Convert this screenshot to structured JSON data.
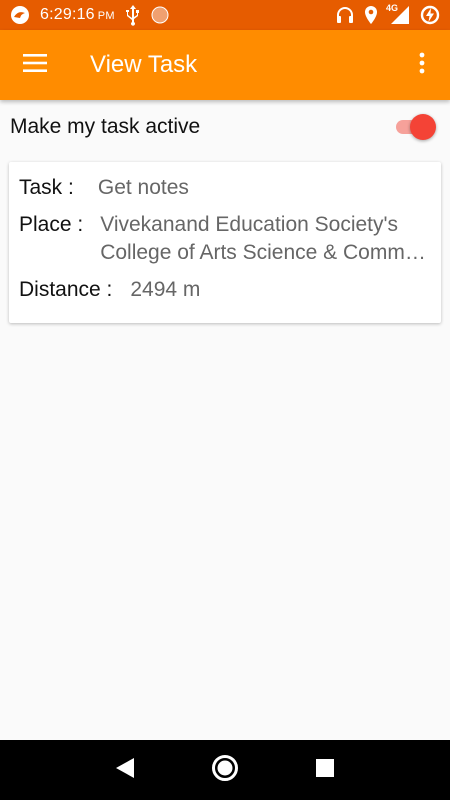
{
  "status_bar": {
    "time": "6:29:16",
    "ampm": "PM",
    "network_label": "4G",
    "icons": [
      "app-notification-icon",
      "usb-icon",
      "circle-notification-icon",
      "headphones-icon",
      "location-icon",
      "signal-icon",
      "battery-charging-icon"
    ]
  },
  "app_bar": {
    "title": "View Task",
    "menu_icon": "hamburger-menu-icon",
    "overflow_icon": "more-vert-icon",
    "color": "#ff8c00"
  },
  "toggle": {
    "label": "Make my task active",
    "checked": true,
    "color": "#f44336"
  },
  "task_card": {
    "task_label": "Task :",
    "task_value": "Get notes",
    "place_label": "Place :",
    "place_value_line1": "Vivekanand Education Society's",
    "place_value_line2": "College of Arts Science & Commerce",
    "distance_label": "Distance  :",
    "distance_value": "2494 m"
  },
  "nav_bar": {
    "back_icon": "back-triangle-icon",
    "home_icon": "home-circle-icon",
    "recents_icon": "recents-square-icon"
  }
}
